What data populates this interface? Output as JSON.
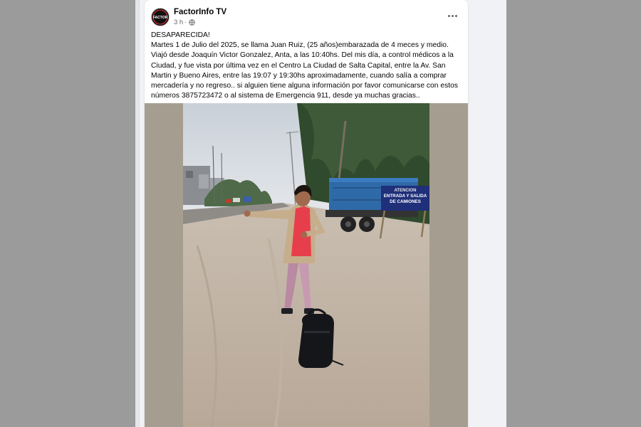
{
  "post": {
    "page_name": "FactorInfo TV",
    "timestamp": "3 h",
    "privacy_icon": "globe-icon",
    "more_icon": "more-options-icon",
    "headline": "DESAPARECIDA!",
    "body": "Martes 1 de Julio del 2025, se llama Juan Ruiz, (25 años)embarazada de 4 meces y medio. Viajó desde Joaquín Victor Gonzalez, Anta, a las 10:40hs. Del mis día, a control médicos a la Ciudad, y fue vista por última vez en el Centro La Ciudad de Salta Capital, entre la Av. San Martin y Bueno Aires, entre las 19:07 y 19:30hs aproximadamente, cuando salía a comprar mercadería y no regreso.. si alguien tiene alguna información por favor comunicarse con estos números 3875723472 o al sistema de Emergencia 911, desde ya muchas gracias..",
    "avatar_logo_text": "FACTOR"
  },
  "photo": {
    "sign_line1": "ATENCION",
    "sign_line2": "ENTRADA Y SALIDA",
    "sign_line3": "DE CAMIONES"
  },
  "colors": {
    "page_background": "#f0f2f5",
    "card_background": "#ffffff",
    "text_primary": "#050505",
    "text_secondary": "#65676b"
  }
}
